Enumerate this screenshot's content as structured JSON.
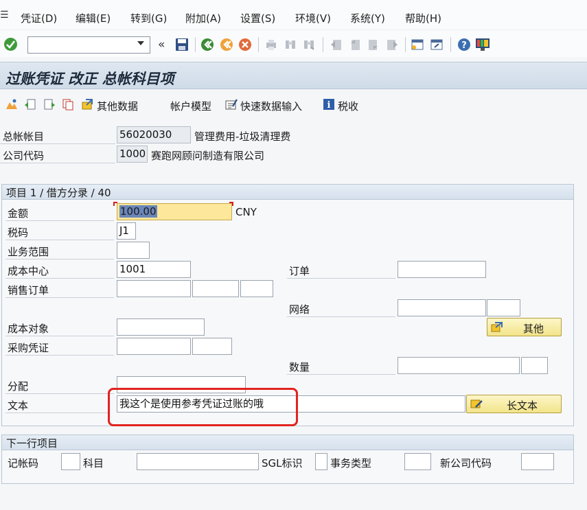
{
  "menu": {
    "items": [
      {
        "label": "凭证(D)"
      },
      {
        "label": "编辑(E)"
      },
      {
        "label": "转到(G)"
      },
      {
        "label": "附加(A)"
      },
      {
        "label": "设置(S)"
      },
      {
        "label": "环境(V)"
      },
      {
        "label": "系统(Y)"
      },
      {
        "label": "帮助(H)"
      }
    ]
  },
  "toolbar": {
    "command_value": "",
    "icons": [
      "enter-check-icon",
      "save-icon",
      "back-icon",
      "exit-icon",
      "cancel-icon",
      "print-icon",
      "find-icon",
      "find-next-icon",
      "first-page-icon",
      "prev-page-icon",
      "next-page-icon",
      "last-page-icon",
      "new-session-icon",
      "shortcut-icon",
      "help-icon",
      "layout-menu-icon"
    ]
  },
  "title": "过账凭证 改正 总帐科目项",
  "app_toolbar": {
    "other_data": "其他数据",
    "account_model": "帐户模型",
    "fast_entry": "快速数据输入",
    "tax": "税收"
  },
  "header": {
    "gl_account_label": "总帐帐目",
    "gl_account_value": "56020030",
    "gl_account_desc": "管理费用-垃圾清理费",
    "company_code_label": "公司代码",
    "company_code_value": "1000",
    "company_code_desc": "赛跑网顾问制造有限公司"
  },
  "item_group": {
    "title": "项目 1 / 借方分录 / 40",
    "amount_label": "金额",
    "amount_value": "100.00",
    "currency": "CNY",
    "tax_code_label": "税码",
    "tax_code_value": "J1",
    "business_area_label": "业务范围",
    "business_area_value": "",
    "cost_center_label": "成本中心",
    "cost_center_value": "1001",
    "order_label": "订单",
    "order_value": "",
    "sales_order_label": "销售订单",
    "network_label": "网络",
    "cost_object_label": "成本对象",
    "more_button": "其他",
    "purchase_doc_label": "采购凭证",
    "quantity_label": "数量",
    "assignment_label": "分配",
    "assignment_value": "",
    "text_label": "文本",
    "text_value": "我这个是使用参考凭证过账的哦",
    "long_text_button": "长文本"
  },
  "next_item": {
    "title": "下一行项目",
    "posting_key_label": "记帐码",
    "account_label": "科目",
    "sgl_label": "SGL标识",
    "trans_type_label": "事务类型",
    "new_company_label": "新公司代码"
  },
  "colors": {
    "title_bg": "#d6e1ed",
    "focus_field": "#fde79a",
    "highlight_box": "#e1231f",
    "button_bg": "#f2e48a"
  }
}
